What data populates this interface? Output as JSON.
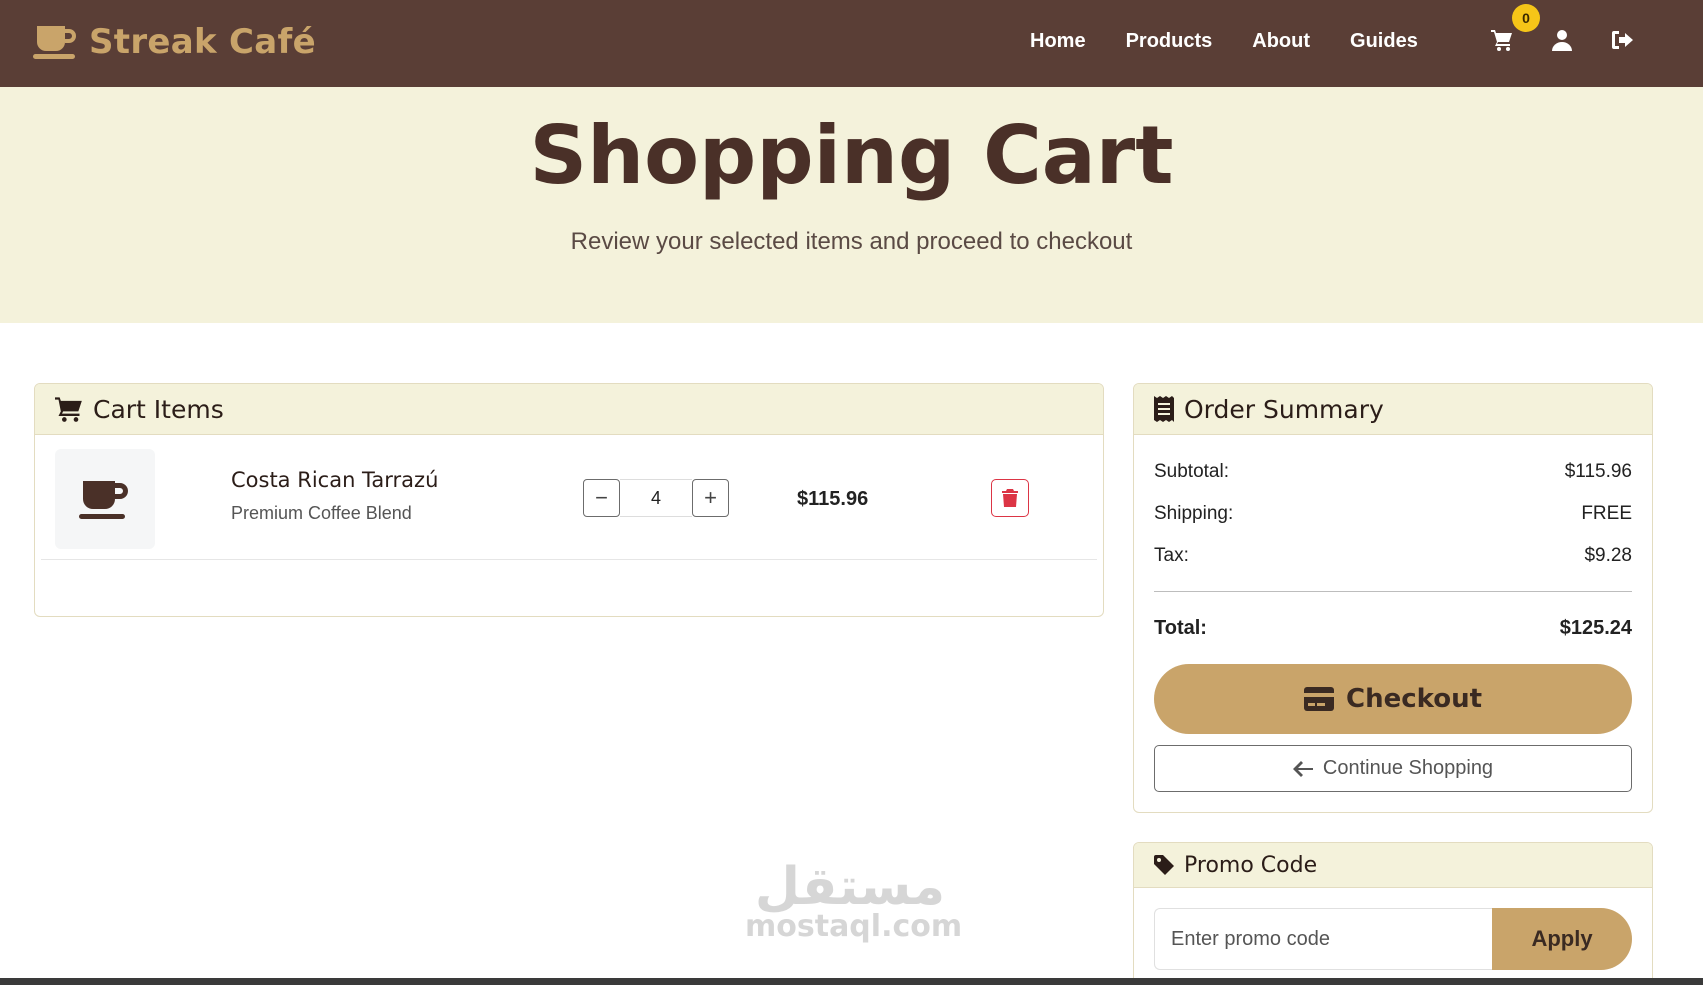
{
  "brand": {
    "name": "Streak Café",
    "icon": "coffee-mug-icon",
    "color": "#c9a46a"
  },
  "nav": {
    "links": [
      "Home",
      "Products",
      "About",
      "Guides"
    ],
    "cart_count": "0",
    "icons": [
      "cart-icon",
      "user-icon",
      "logout-icon"
    ]
  },
  "hero": {
    "title": "Shopping Cart",
    "subtitle": "Review your selected items and proceed to checkout"
  },
  "cart": {
    "header": "Cart Items",
    "items": [
      {
        "name": "Costa Rican Tarrazú",
        "description": "Premium Coffee Blend",
        "quantity": "4",
        "price": "$115.96",
        "icon": "coffee-cup-icon"
      }
    ]
  },
  "summary": {
    "header": "Order Summary",
    "subtotal_label": "Subtotal:",
    "subtotal": "$115.96",
    "shipping_label": "Shipping:",
    "shipping": "FREE",
    "tax_label": "Tax:",
    "tax": "$9.28",
    "total_label": "Total:",
    "total": "$125.24",
    "checkout_label": "Checkout",
    "continue_label": "Continue Shopping"
  },
  "promo": {
    "header": "Promo Code",
    "placeholder": "Enter promo code",
    "apply_label": "Apply"
  },
  "watermark": {
    "arabic": "مستقل",
    "latin": "mostaql.com"
  },
  "colors": {
    "nav_bg": "#5a3e36",
    "hero_bg": "#f4f2db",
    "accent": "#c9a46a",
    "danger": "#dc3545",
    "badge": "#f5c518"
  }
}
